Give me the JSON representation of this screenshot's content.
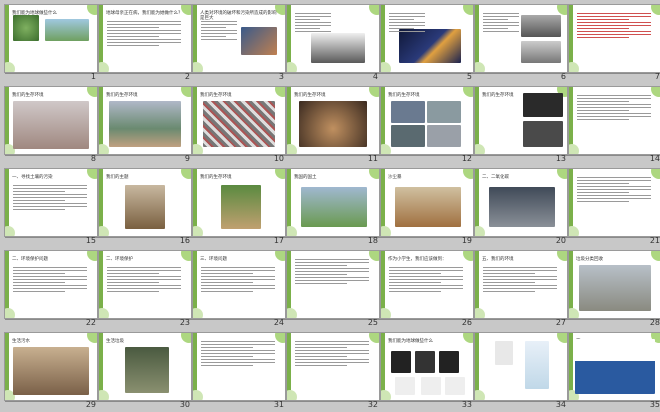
{
  "colors": {
    "accent": "#7bb04a",
    "background": "#c8c8c8",
    "slide_border": "#9a9a9a",
    "highlight": "#c00000"
  },
  "slides": [
    {
      "n": "1",
      "title": "我们能为地球做些什么",
      "type": "cover"
    },
    {
      "n": "2",
      "title": "地球母亲正在病，我们能为她做什么？",
      "type": "text"
    },
    {
      "n": "3",
      "title": "人类对环境的破坏和污染所造成的影响是巨大",
      "type": "text-image"
    },
    {
      "n": "4",
      "title": "",
      "type": "text-image"
    },
    {
      "n": "5",
      "title": "",
      "type": "text-image"
    },
    {
      "n": "6",
      "title": "",
      "type": "text-image"
    },
    {
      "n": "7",
      "title": "",
      "type": "red-text"
    },
    {
      "n": "8",
      "title": "我们的生存环境",
      "type": "image"
    },
    {
      "n": "9",
      "title": "我们的生存环境",
      "type": "image"
    },
    {
      "n": "10",
      "title": "我们的生存环境",
      "type": "image"
    },
    {
      "n": "11",
      "title": "我们的生存环境",
      "type": "image"
    },
    {
      "n": "12",
      "title": "我们的生存环境",
      "type": "image"
    },
    {
      "n": "13",
      "title": "我们的生存环境",
      "type": "image"
    },
    {
      "n": "14",
      "title": "",
      "type": "text"
    },
    {
      "n": "15",
      "title": "一、寻找土壤的污染",
      "type": "text"
    },
    {
      "n": "16",
      "title": "我们的主题",
      "type": "image"
    },
    {
      "n": "17",
      "title": "我们的生存环境",
      "type": "image"
    },
    {
      "n": "18",
      "title": "我国的国土",
      "type": "image"
    },
    {
      "n": "19",
      "title": "沙尘暴",
      "type": "image"
    },
    {
      "n": "20",
      "title": "二、二氧化碳",
      "type": "image"
    },
    {
      "n": "21",
      "title": "",
      "type": "text"
    },
    {
      "n": "22",
      "title": "二、环境保护问题",
      "type": "text"
    },
    {
      "n": "23",
      "title": "二、环境保护",
      "type": "text"
    },
    {
      "n": "24",
      "title": "三、环境问题",
      "type": "text"
    },
    {
      "n": "25",
      "title": "",
      "type": "text"
    },
    {
      "n": "26",
      "title": "作为小学生，我们应该做到：",
      "type": "text"
    },
    {
      "n": "27",
      "title": "五、我们的环境",
      "type": "text"
    },
    {
      "n": "28",
      "title": "垃圾分类回收",
      "type": "image"
    },
    {
      "n": "29",
      "title": "生活污水",
      "type": "image"
    },
    {
      "n": "30",
      "title": "生活垃圾",
      "type": "image"
    },
    {
      "n": "31",
      "title": "",
      "type": "text"
    },
    {
      "n": "32",
      "title": "",
      "type": "text"
    },
    {
      "n": "33",
      "title": "我们能为地球做些什么",
      "type": "image"
    },
    {
      "n": "34",
      "title": "",
      "type": "image"
    },
    {
      "n": "35",
      "title": "第1PPT",
      "type": "logo"
    }
  ]
}
